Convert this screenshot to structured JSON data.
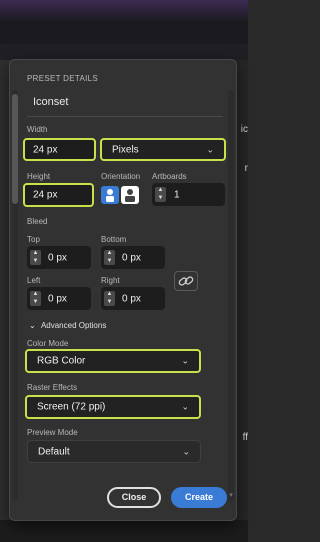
{
  "dialog": {
    "section_title": "PRESET DETAILS",
    "preset_name": "Iconset",
    "width": {
      "label": "Width",
      "value": "24 px",
      "unit": "Pixels"
    },
    "height": {
      "label": "Height",
      "value": "24 px"
    },
    "orientation": {
      "label": "Orientation",
      "selected": "portrait"
    },
    "artboards": {
      "label": "Artboards",
      "value": "1"
    },
    "bleed": {
      "label": "Bleed",
      "top": {
        "label": "Top",
        "value": "0 px"
      },
      "bottom": {
        "label": "Bottom",
        "value": "0 px"
      },
      "left": {
        "label": "Left",
        "value": "0 px"
      },
      "right": {
        "label": "Right",
        "value": "0 px"
      }
    },
    "advanced_label": "Advanced Options",
    "color_mode": {
      "label": "Color Mode",
      "value": "RGB Color"
    },
    "raster_effects": {
      "label": "Raster Effects",
      "value": "Screen (72 ppi)"
    },
    "preview_mode": {
      "label": "Preview Mode",
      "value": "Default"
    },
    "buttons": {
      "close": "Close",
      "create": "Create"
    }
  },
  "background": {
    "right_fragment_1": "ic",
    "right_fragment_2": "r",
    "right_fragment_3": "ff"
  },
  "colors": {
    "highlight": "#c8e04a",
    "accent": "#3a7bd5",
    "panel": "#323232"
  }
}
